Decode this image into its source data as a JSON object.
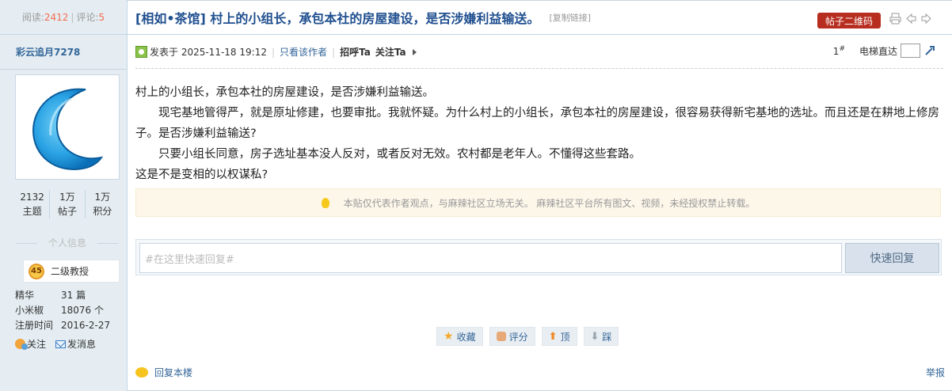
{
  "left_top": {
    "read_label": "阅读:",
    "read_value": "2412",
    "sep": "|",
    "comment_label": "评论:",
    "comment_value": "5"
  },
  "author": {
    "name": "彩云追月7278"
  },
  "stats": [
    {
      "value": "2132",
      "label": "主题"
    },
    {
      "value": "1万",
      "label": "帖子"
    },
    {
      "value": "1万",
      "label": "积分"
    }
  ],
  "personal_info_label": "个人信息",
  "level": {
    "number": "45",
    "name": "二级教授"
  },
  "info_rows": [
    {
      "key": "精华",
      "value": "31 篇"
    },
    {
      "key": "小米椒",
      "value": "18076 个"
    },
    {
      "key": "注册时间",
      "value": "2016-2-27"
    }
  ],
  "actions": {
    "follow": "关注",
    "message": "发消息"
  },
  "title": {
    "text": "[相如•茶馆] 村上的小组长，承包本社的房屋建设，是否涉嫌利益输送。",
    "copy_link": "[复制链接]",
    "qr_button": "帖子二维码"
  },
  "meta": {
    "posted": "发表于 2025-11-18 19:12",
    "sep": "|",
    "only_author": "只看该作者",
    "greet": "招呼Ta",
    "follow": "关注Ta",
    "floor": "1",
    "floor_mark": "#",
    "elevator": "电梯直达"
  },
  "content": {
    "p1": "村上的小组长，承包本社的房屋建设，是否涉嫌利益输送。",
    "p2": "　　现宅基地管得严，就是原址修建，也要审批。我就怀疑。为什么村上的小组长，承包本社的房屋建设，很容易获得新宅基地的选址。而且还是在耕地上修房子。是否涉嫌利益输送?",
    "p3": "　　只要小组长同意，房子选址基本没人反对，或者反对无效。农村都是老年人。不懂得这些套路。",
    "p4": "这是不是变相的以权谋私?"
  },
  "notice": "本贴仅代表作者观点，与麻辣社区立场无关。  麻辣社区平台所有图文、视频，未经授权禁止转载。",
  "reply": {
    "placeholder": "#在这里快速回复#",
    "button": "快速回复"
  },
  "bottom_buttons": {
    "favorite": "收藏",
    "rate": "评分",
    "up": "顶",
    "down": "踩"
  },
  "footer": {
    "reply_floor": "回复本楼",
    "report": "举报"
  }
}
